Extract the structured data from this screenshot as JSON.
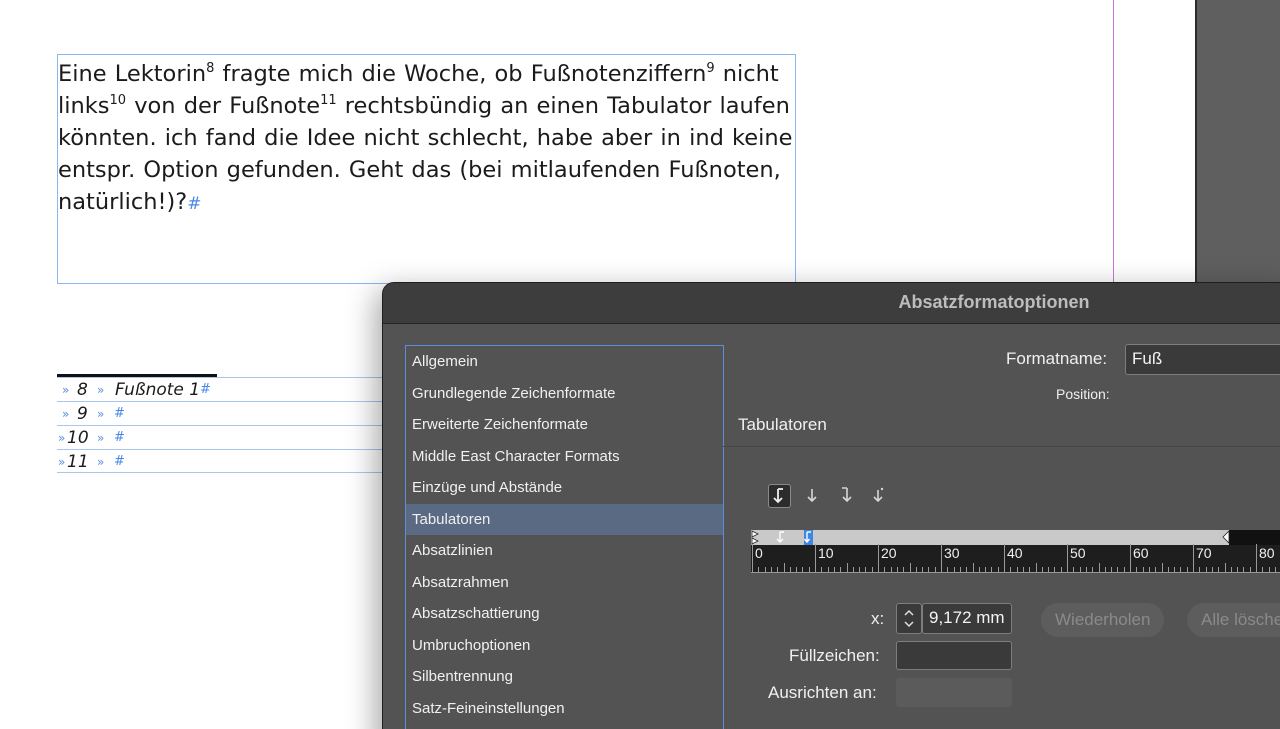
{
  "document": {
    "body_text": {
      "line1": {
        "a": "Eine Lektorin",
        "s1": "8",
        "b": " fragte mich die Woche, ob Fußnotenziffern",
        "s2": "9",
        "c": " nicht"
      },
      "line2": {
        "a": "links",
        "s1": "10",
        "b": " von der Fußnote",
        "s2": "11",
        "c": " rechtsbündig an einen Tabulator laufen"
      },
      "line3": "könnten. ich fand die Idee nicht schlecht, habe aber in ind keine",
      "line4": "entspr. Option gefunden. Geht das (bei mitlaufenden Fußnoten,",
      "line5": "natürlich!)?",
      "end_mark": "#"
    },
    "footnotes": [
      {
        "tab_mark": "»",
        "number": "8",
        "text": "Fußnote 1",
        "end_mark": "#"
      },
      {
        "tab_mark": "»",
        "number": "9",
        "text": "",
        "end_mark": "#"
      },
      {
        "tab_mark": "»",
        "number": "10",
        "text": "",
        "end_mark": "#"
      },
      {
        "tab_mark": "»",
        "number": "11",
        "text": "",
        "end_mark": "#"
      }
    ]
  },
  "dialog": {
    "title": "Absatzformatoptionen",
    "categories": [
      {
        "label": "Allgemein",
        "selected": false
      },
      {
        "label": "Grundlegende Zeichenformate",
        "selected": false
      },
      {
        "label": "Erweiterte Zeichenformate",
        "selected": false
      },
      {
        "label": "Middle East Character Formats",
        "selected": false
      },
      {
        "label": "Einzüge und Abstände",
        "selected": false
      },
      {
        "label": "Tabulatoren",
        "selected": true
      },
      {
        "label": "Absatzlinien",
        "selected": false
      },
      {
        "label": "Absatzrahmen",
        "selected": false
      },
      {
        "label": "Absatzschattierung",
        "selected": false
      },
      {
        "label": "Umbruchoptionen",
        "selected": false
      },
      {
        "label": "Silbentrennung",
        "selected": false
      },
      {
        "label": "Satz-Feineinstellungen",
        "selected": false
      }
    ],
    "format_name_label": "Formatname:",
    "format_name_value": "Fuß",
    "position_label": "Position:",
    "section_title": "Tabulatoren",
    "tab_types": [
      {
        "name": "left-justified-tab-icon",
        "active": true
      },
      {
        "name": "center-justified-tab-icon",
        "active": false
      },
      {
        "name": "right-justified-tab-icon",
        "active": false
      },
      {
        "name": "align-to-decimal-tab-icon",
        "active": false
      }
    ],
    "ruler": {
      "labels": [
        "0",
        "10",
        "20",
        "30",
        "40",
        "50",
        "60",
        "70",
        "80"
      ],
      "tab_position_mm": 9.172
    },
    "x_label": "x:",
    "x_value": "9,172 mm",
    "repeat_button": "Wiederholen",
    "clear_all_button": "Alle löschen",
    "leader_label": "Füllzeichen:",
    "leader_value": "",
    "align_on_label": "Ausrichten an:",
    "align_on_value": ""
  },
  "colors": {
    "frame_edge": "#8bb7ef",
    "hidden_chars": "#4a88e6",
    "margin_guide": "#c879d6",
    "dialog_bg": "#535353",
    "list_selection": "#5b6a83",
    "focus_ring": "#5b8fdc"
  }
}
